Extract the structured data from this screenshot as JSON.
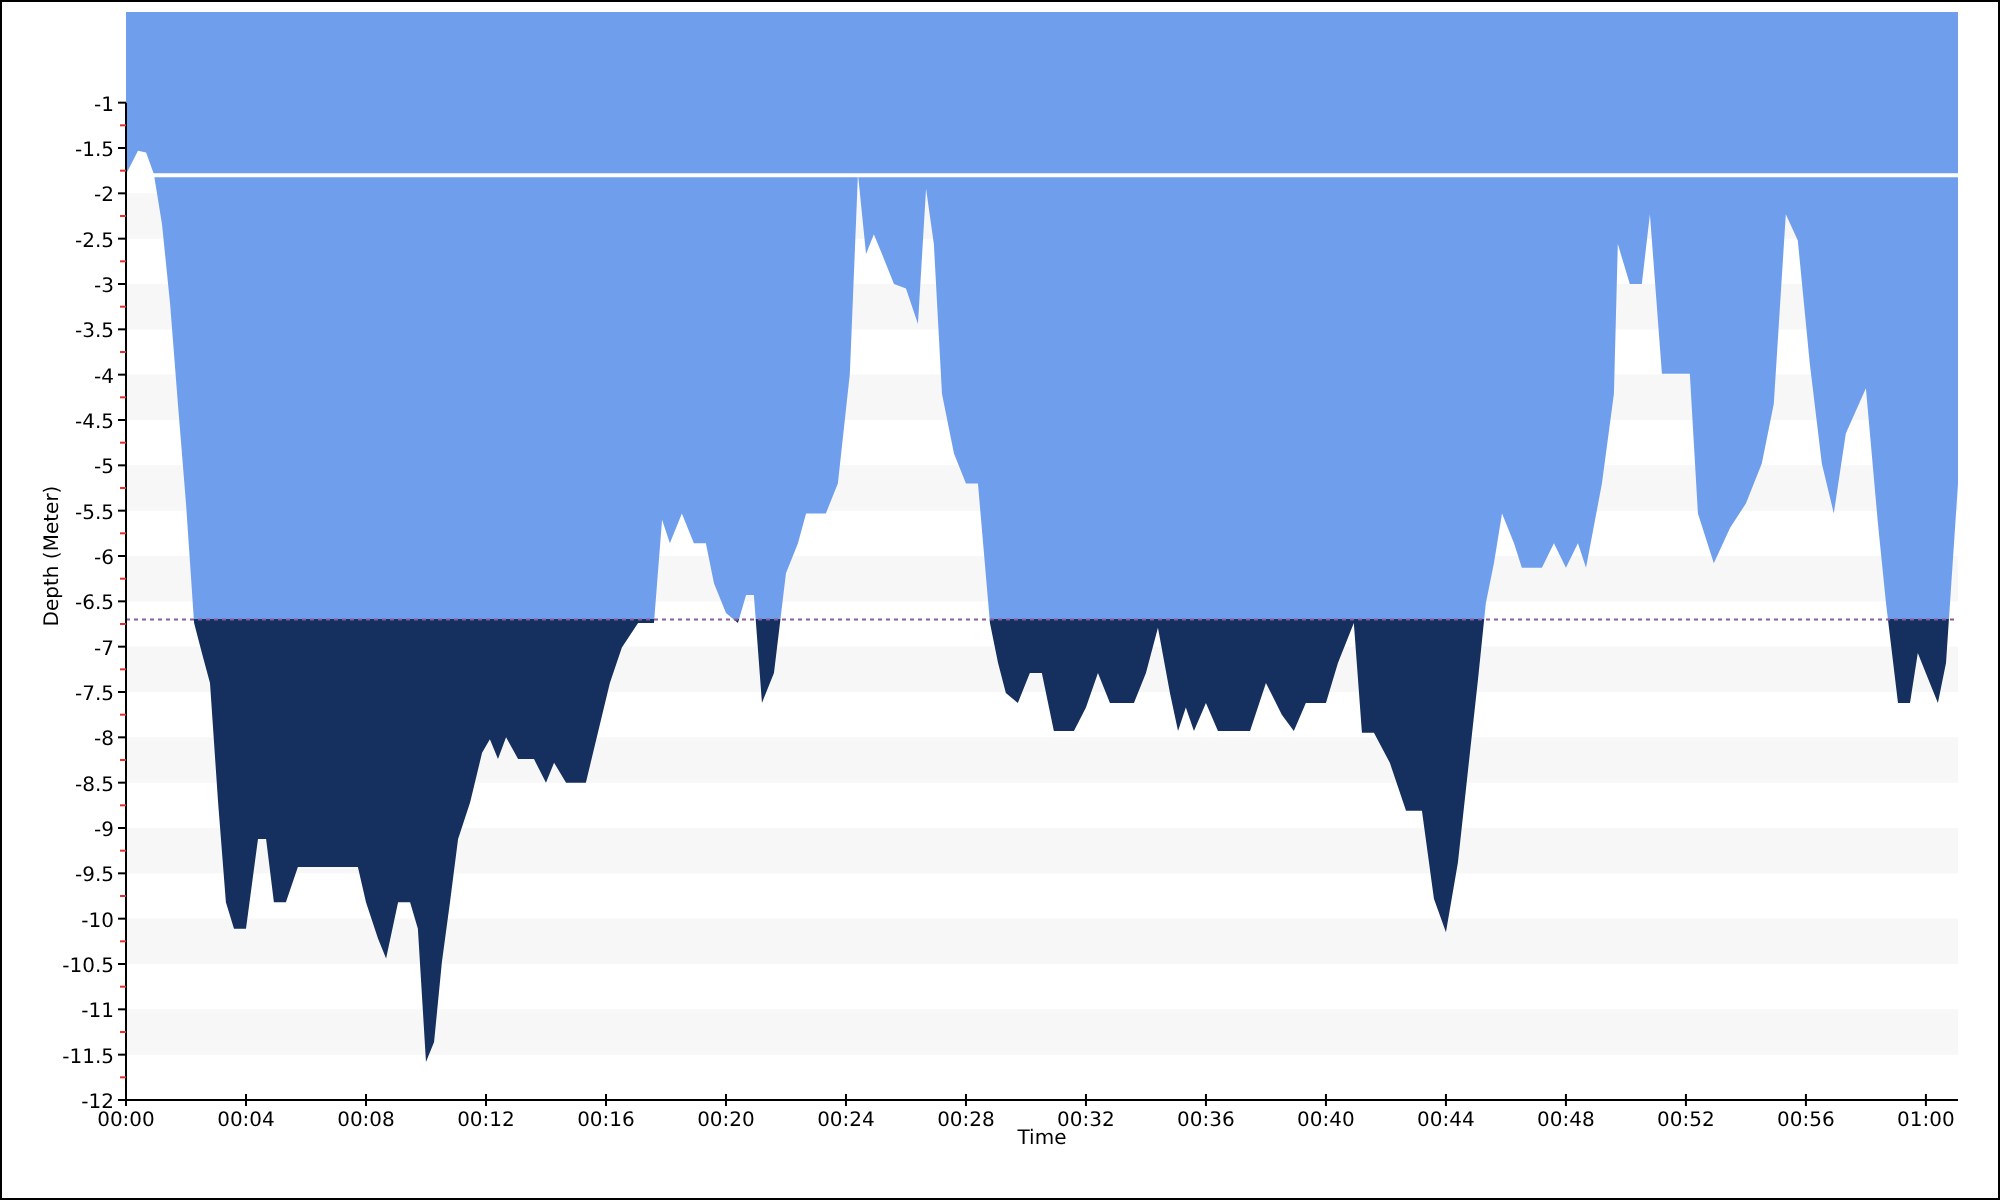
{
  "chart_data": {
    "type": "area",
    "xlabel": "Time",
    "ylabel": "Depth (Meter)",
    "xlim": [
      0,
      61.07
    ],
    "ylim": [
      -12,
      0
    ],
    "xticks": [
      {
        "value": 0,
        "label": "00:00"
      },
      {
        "value": 4,
        "label": "00:04"
      },
      {
        "value": 8,
        "label": "00:08"
      },
      {
        "value": 12,
        "label": "00:12"
      },
      {
        "value": 16,
        "label": "00:16"
      },
      {
        "value": 20,
        "label": "00:20"
      },
      {
        "value": 24,
        "label": "00:24"
      },
      {
        "value": 28,
        "label": "00:28"
      },
      {
        "value": 32,
        "label": "00:32"
      },
      {
        "value": 36,
        "label": "00:36"
      },
      {
        "value": 40,
        "label": "00:40"
      },
      {
        "value": 44,
        "label": "00:44"
      },
      {
        "value": 48,
        "label": "00:48"
      },
      {
        "value": 52,
        "label": "00:52"
      },
      {
        "value": 56,
        "label": "00:56"
      },
      {
        "value": 60,
        "label": "01:00"
      }
    ],
    "yticks": [
      -12,
      -11.5,
      -11,
      -10.5,
      -10,
      -9.5,
      -9,
      -8.5,
      -8,
      -7.5,
      -7,
      -6.5,
      -6,
      -5.5,
      -5,
      -4.5,
      -4,
      -3.5,
      -3,
      -2.5,
      -2,
      -1.5,
      -1
    ],
    "x": [
      0,
      0.4,
      0.67,
      0.93,
      1.2,
      1.47,
      1.73,
      2.0,
      2.27,
      2.53,
      2.8,
      3.07,
      3.33,
      3.6,
      4.0,
      4.4,
      4.67,
      4.93,
      5.33,
      5.73,
      7.73,
      8.0,
      8.4,
      8.67,
      9.07,
      9.47,
      9.73,
      10.0,
      10.27,
      10.53,
      10.8,
      11.07,
      11.47,
      11.87,
      12.13,
      12.4,
      12.67,
      13.07,
      13.6,
      14.0,
      14.27,
      14.67,
      15.33,
      15.73,
      16.13,
      16.53,
      17.07,
      17.6,
      17.87,
      18.13,
      18.53,
      18.93,
      19.33,
      19.6,
      20.0,
      20.4,
      20.67,
      20.93,
      21.2,
      21.6,
      22.0,
      22.4,
      22.67,
      23.33,
      23.73,
      24.13,
      24.4,
      24.67,
      24.93,
      25.2,
      25.6,
      26.0,
      26.4,
      26.67,
      26.93,
      27.2,
      27.6,
      28.0,
      28.4,
      28.8,
      29.07,
      29.33,
      29.73,
      30.13,
      30.53,
      30.93,
      31.6,
      32.0,
      32.4,
      32.8,
      33.6,
      34.0,
      34.4,
      34.8,
      35.07,
      35.33,
      35.6,
      36.0,
      36.4,
      37.47,
      38.0,
      38.53,
      38.93,
      39.33,
      40.0,
      40.4,
      40.93,
      41.2,
      41.6,
      42.13,
      42.67,
      43.2,
      43.6,
      44.0,
      44.4,
      44.8,
      45.07,
      45.33,
      45.6,
      45.87,
      46.27,
      46.53,
      47.2,
      47.6,
      48.0,
      48.4,
      48.67,
      49.2,
      49.6,
      49.73,
      50.13,
      50.53,
      50.8,
      51.2,
      52.13,
      52.4,
      52.93,
      53.47,
      54.0,
      54.53,
      54.93,
      55.33,
      55.73,
      56.13,
      56.53,
      56.93,
      57.33,
      58.0,
      58.4,
      58.67,
      59.07,
      59.47,
      59.73,
      60.13,
      60.4,
      60.67,
      61.07
    ],
    "series": [
      {
        "color": "#6f9fec",
        "values": [
          -1.79,
          -1.53,
          -1.55,
          -1.79,
          -2.34,
          -3.22,
          -4.32,
          -5.42,
          -6.74,
          -7.07,
          -7.4,
          -8.72,
          -9.82,
          -10.11,
          -10.11,
          -9.12,
          -9.12,
          -9.82,
          -9.82,
          -9.43,
          -9.43,
          -9.82,
          -10.22,
          -10.44,
          -9.82,
          -9.82,
          -10.11,
          -11.58,
          -11.36,
          -10.48,
          -9.82,
          -9.12,
          -8.72,
          -8.17,
          -8.02,
          -8.24,
          -8.0,
          -8.24,
          -8.24,
          -8.5,
          -8.28,
          -8.5,
          -8.5,
          -7.95,
          -7.4,
          -7.01,
          -6.74,
          -6.74,
          -5.6,
          -5.86,
          -5.53,
          -5.86,
          -5.86,
          -6.3,
          -6.63,
          -6.74,
          -6.43,
          -6.43,
          -7.62,
          -7.29,
          -6.19,
          -5.86,
          -5.53,
          -5.53,
          -5.2,
          -3.99,
          -1.79,
          -2.67,
          -2.45,
          -2.67,
          -3.0,
          -3.05,
          -3.44,
          -1.95,
          -2.56,
          -4.21,
          -4.87,
          -5.2,
          -5.2,
          -6.74,
          -7.18,
          -7.51,
          -7.62,
          -7.29,
          -7.29,
          -7.93,
          -7.93,
          -7.67,
          -7.29,
          -7.62,
          -7.62,
          -7.29,
          -6.79,
          -7.51,
          -7.93,
          -7.67,
          -7.93,
          -7.62,
          -7.93,
          -7.93,
          -7.4,
          -7.75,
          -7.93,
          -7.62,
          -7.62,
          -7.18,
          -6.74,
          -7.95,
          -7.95,
          -8.28,
          -8.81,
          -8.81,
          -9.78,
          -10.15,
          -9.38,
          -8.17,
          -7.36,
          -6.52,
          -6.08,
          -5.53,
          -5.86,
          -6.13,
          -6.13,
          -5.86,
          -6.13,
          -5.86,
          -6.13,
          -5.2,
          -4.21,
          -2.56,
          -3.0,
          -3.0,
          -2.23,
          -3.99,
          -3.99,
          -5.53,
          -6.08,
          -5.69,
          -5.42,
          -4.98,
          -4.32,
          -2.23,
          -2.52,
          -3.88,
          -4.98,
          -5.53,
          -4.65,
          -4.15,
          -5.64,
          -6.52,
          -7.62,
          -7.62,
          -7.07,
          -7.4,
          -7.62,
          -7.18,
          -5.2
        ]
      }
    ],
    "ref_lines": [
      {
        "axis": "y",
        "value": -1.8,
        "color": "#ffffff"
      },
      {
        "axis": "y",
        "value": -6.7,
        "color": "#8a5a9a"
      }
    ]
  }
}
